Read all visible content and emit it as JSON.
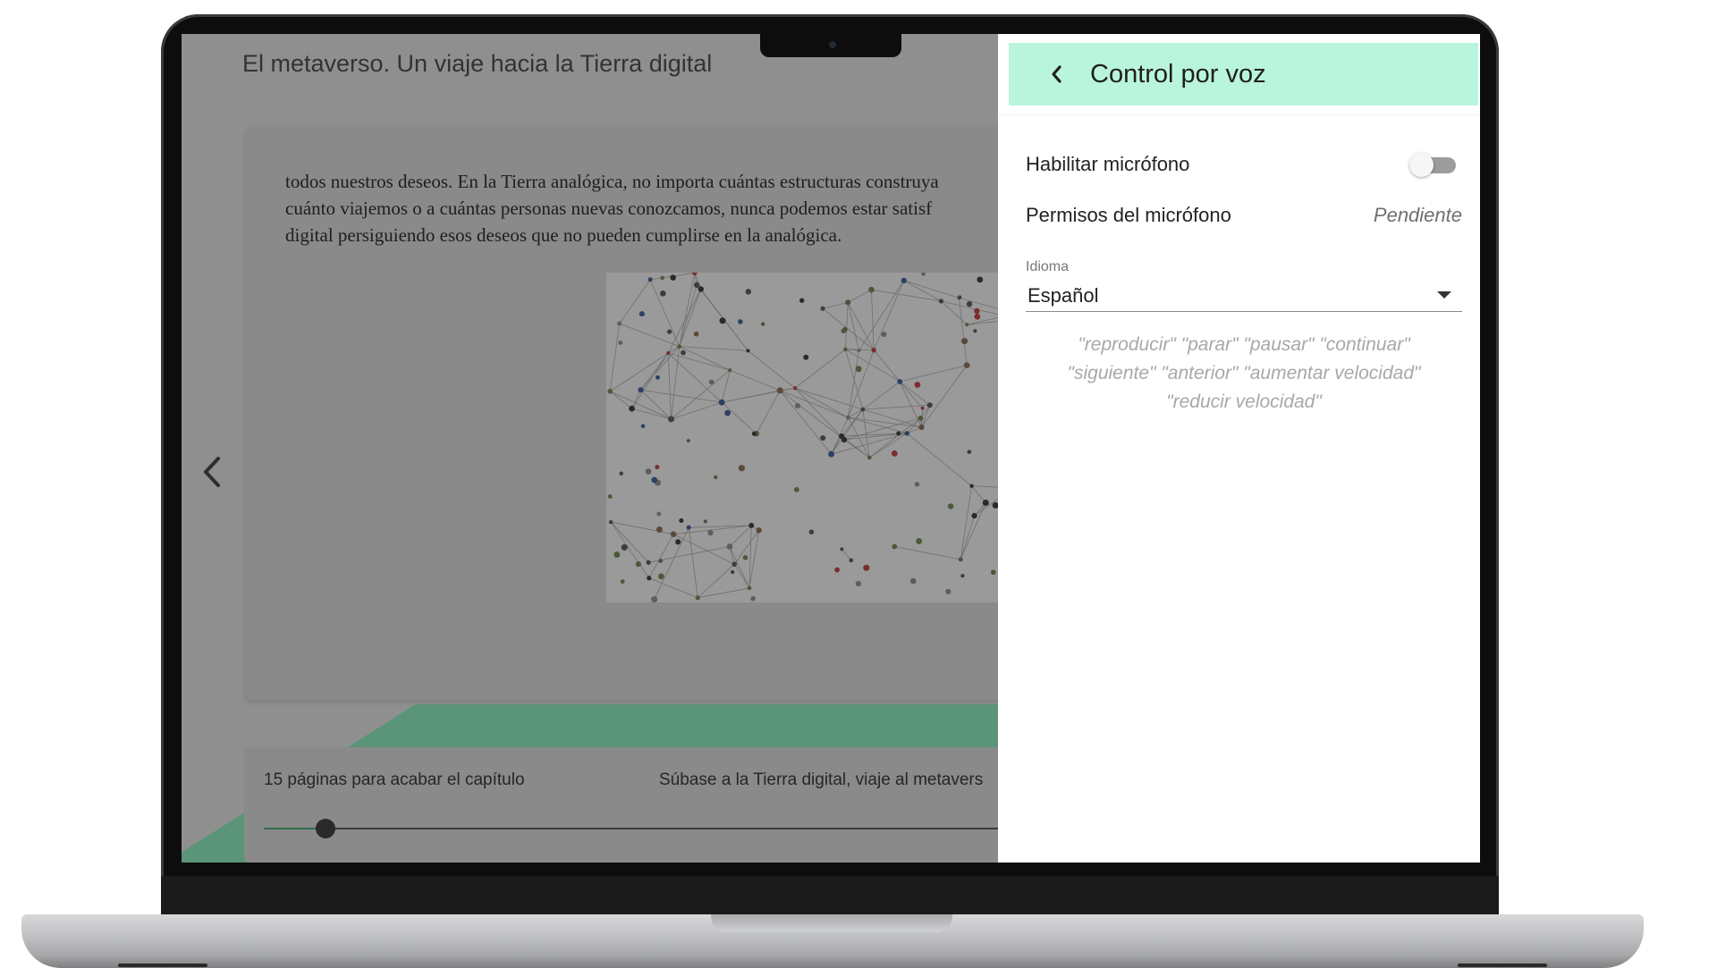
{
  "reader": {
    "title": "El metaverso. Un viaje hacia la Tierra digital",
    "page_text_lines": [
      "todos nuestros deseos. En la Tierra analógica, no importa cuántas estructuras construya",
      "cuánto viajemos o a cuántas personas nuevas conozcamos, nunca podemos estar satisf",
      "digital persiguiendo esos deseos que no pueden cumplirse en la analógica."
    ],
    "image_alt": "Vista aérea de una multitud conectada por líneas",
    "progress": {
      "pages_left_label": "15 páginas para acabar el capítulo",
      "chapter_label": "Súbase a la Tierra digital, viaje al metavers",
      "position_fraction": 0.07
    }
  },
  "voice_panel": {
    "title": "Control por voz",
    "enable_mic_label": "Habilitar micrófono",
    "enable_mic_on": false,
    "permissions_label": "Permisos del micrófono",
    "permissions_status": "Pendiente",
    "language_label": "Idioma",
    "language_value": "Español",
    "commands_line1": "\"reproducir\" \"parar\" \"pausar\" \"continuar\"",
    "commands_line2": "\"siguiente\" \"anterior\" \"aumentar velocidad\"",
    "commands_line3": "\"reducir velocidad\""
  },
  "colors": {
    "panel_header": "#b9f5dc",
    "accent_green": "#5a9579",
    "dim_background": "#8f8f8f"
  },
  "icons": {
    "back": "chevron-left-icon",
    "prev_page": "chevron-left-icon",
    "dropdown": "caret-down-icon"
  }
}
